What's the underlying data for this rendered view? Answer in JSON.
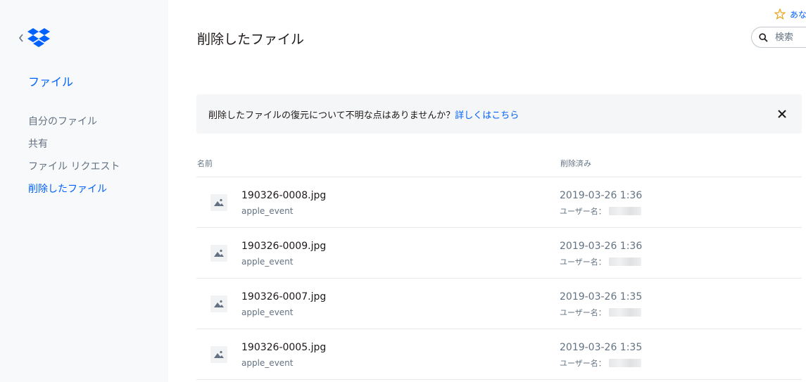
{
  "sidebar": {
    "title": "ファイル",
    "items": [
      {
        "label": "自分のファイル"
      },
      {
        "label": "共有"
      },
      {
        "label": "ファイル リクエスト"
      },
      {
        "label": "削除したファイル",
        "active": true
      }
    ]
  },
  "header": {
    "title": "削除したファイル",
    "star_label": "あな",
    "search_placeholder": "検索"
  },
  "banner": {
    "text": "削除したファイルの復元について不明な点はありませんか？",
    "link": "詳しくはこちら"
  },
  "table": {
    "columns": {
      "name": "名前",
      "deleted": "削除済み"
    },
    "rows": [
      {
        "name": "190326-0008.jpg",
        "folder": "apple_event",
        "date": "2019-03-26 1:36",
        "user_label": "ユーザー名："
      },
      {
        "name": "190326-0009.jpg",
        "folder": "apple_event",
        "date": "2019-03-26 1:36",
        "user_label": "ユーザー名："
      },
      {
        "name": "190326-0007.jpg",
        "folder": "apple_event",
        "date": "2019-03-26 1:35",
        "user_label": "ユーザー名："
      },
      {
        "name": "190326-0005.jpg",
        "folder": "apple_event",
        "date": "2019-03-26 1:35",
        "user_label": "ユーザー名："
      }
    ]
  },
  "colors": {
    "accent": "#0061fe",
    "sidebar_bg": "#f7f9fa",
    "muted_text": "#637282",
    "star": "#e8a317"
  },
  "icons": [
    "chevron-left-icon",
    "dropbox-logo-icon",
    "star-icon",
    "search-icon",
    "close-icon",
    "image-file-icon"
  ]
}
